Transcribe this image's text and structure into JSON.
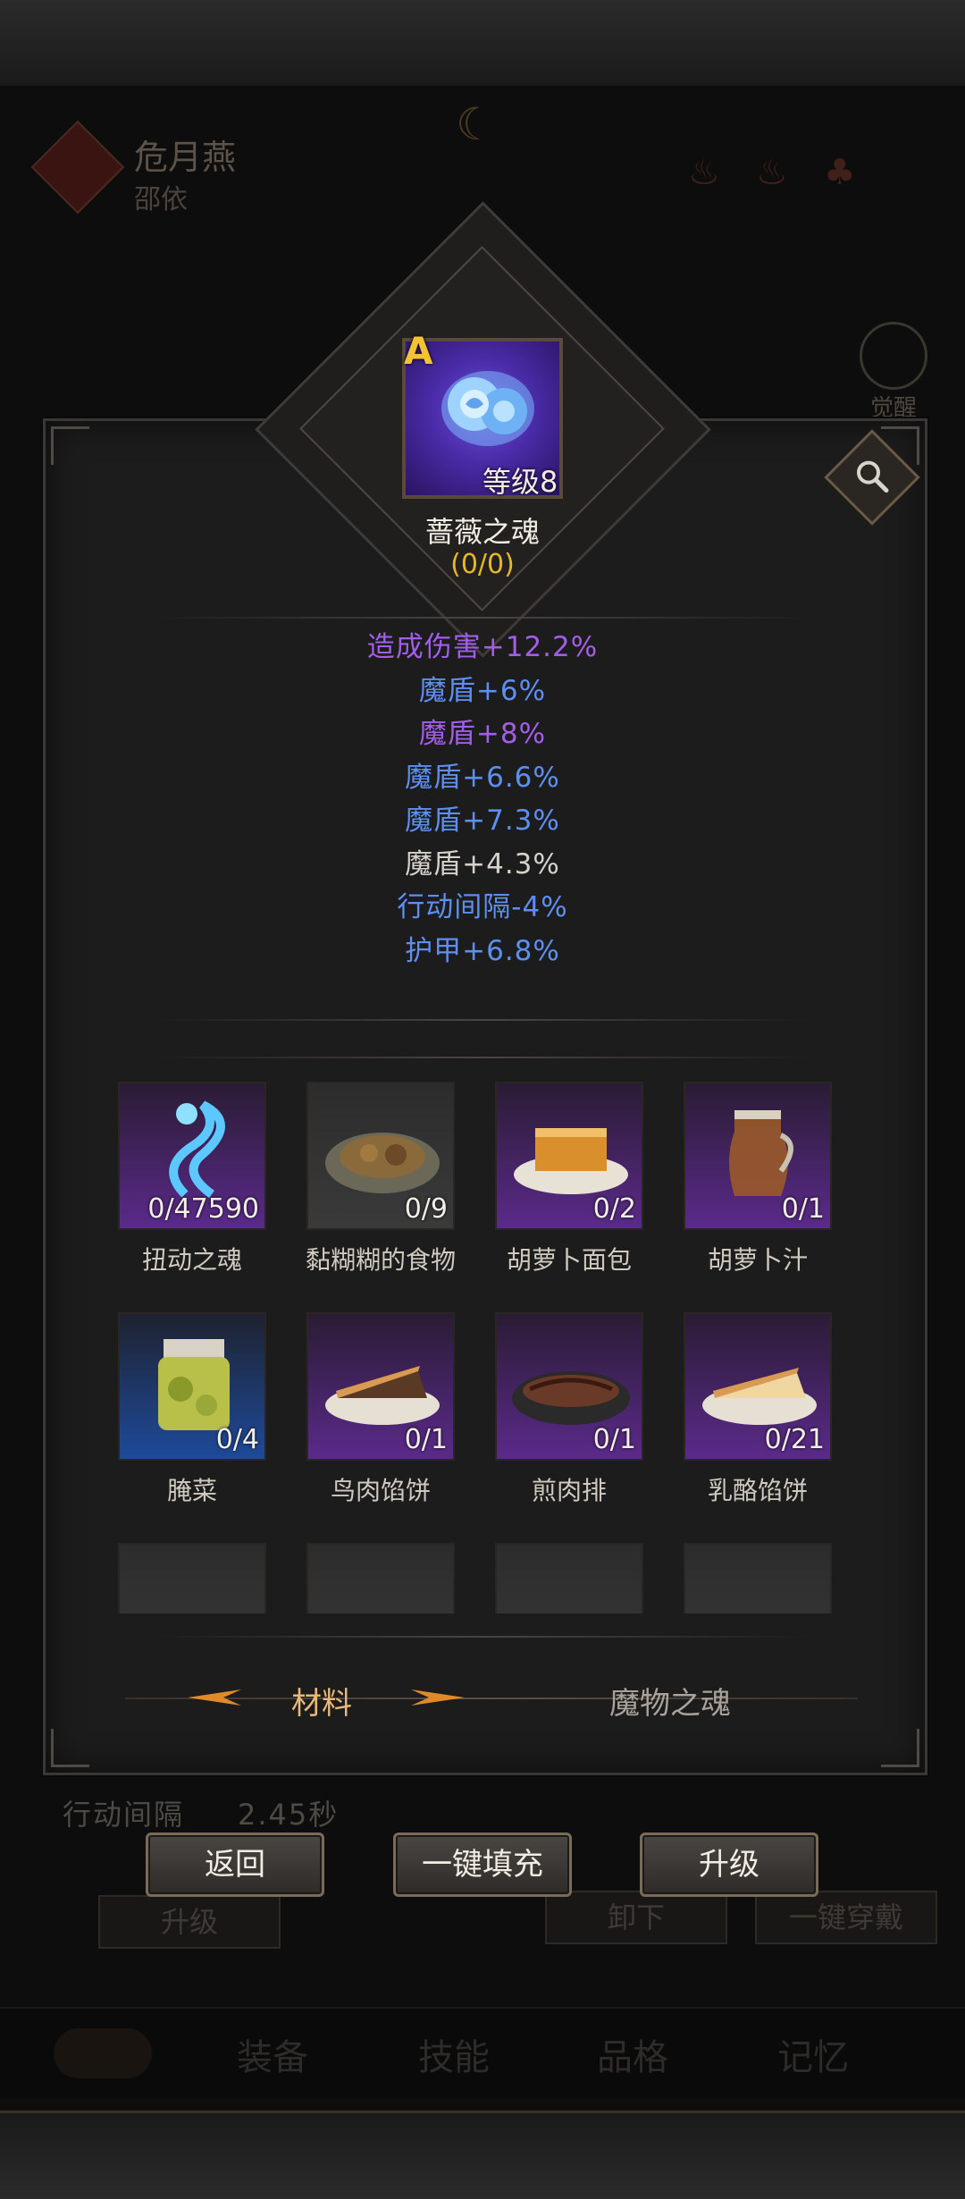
{
  "background": {
    "character_name": "危月燕",
    "character_sub": "邵依",
    "awaken_label": "觉醒",
    "interval_label": "行动间隔",
    "interval_value": "2.45秒",
    "buttons": [
      "升级",
      "卸下",
      "一键穿戴"
    ],
    "tabs": [
      "装备",
      "技能",
      "品格",
      "记忆"
    ]
  },
  "item": {
    "grade": "A",
    "level": "等级8",
    "name": "蔷薇之魂",
    "count": "(0/0)",
    "colors": {
      "grade": "#f3c331",
      "count": "#e7b72a"
    }
  },
  "stats": [
    {
      "text": "造成伤害+12.2%",
      "color": "#a25ee8"
    },
    {
      "text": "魔盾+6%",
      "color": "#5d8ef0"
    },
    {
      "text": "魔盾+8%",
      "color": "#a25ee8"
    },
    {
      "text": "魔盾+6.6%",
      "color": "#5d8ef0"
    },
    {
      "text": "魔盾+7.3%",
      "color": "#5d8ef0"
    },
    {
      "text": "魔盾+4.3%",
      "color": "#d6d2cb"
    },
    {
      "text": "行动间隔-4%",
      "color": "#5d8ef0"
    },
    {
      "text": "护甲+6.8%",
      "color": "#5d8ef0"
    }
  ],
  "materials": [
    {
      "name": "扭动之魂",
      "count": "0/47590",
      "rarity": "purple",
      "icon": "wisp-icon"
    },
    {
      "name": "黏糊糊的食物",
      "count": "0/9",
      "rarity": "gray",
      "icon": "mush-plate-icon"
    },
    {
      "name": "胡萝卜面包",
      "count": "0/2",
      "rarity": "purple",
      "icon": "bread-icon"
    },
    {
      "name": "胡萝卜汁",
      "count": "0/1",
      "rarity": "purple",
      "icon": "juice-jug-icon"
    },
    {
      "name": "腌菜",
      "count": "0/4",
      "rarity": "blue",
      "icon": "pickle-jar-icon"
    },
    {
      "name": "鸟肉馅饼",
      "count": "0/1",
      "rarity": "purple",
      "icon": "meat-pie-icon"
    },
    {
      "name": "煎肉排",
      "count": "0/1",
      "rarity": "purple",
      "icon": "steak-icon"
    },
    {
      "name": "乳酪馅饼",
      "count": "0/21",
      "rarity": "purple",
      "icon": "cheese-pie-icon"
    },
    {
      "name": "",
      "count": "",
      "rarity": "gray",
      "icon": "pie-icon"
    },
    {
      "name": "",
      "count": "",
      "rarity": "gray",
      "icon": "stew-icon"
    },
    {
      "name": "",
      "count": "",
      "rarity": "gray",
      "icon": "dish-icon"
    },
    {
      "name": "",
      "count": "",
      "rarity": "gray",
      "icon": "meat-icon"
    }
  ],
  "tabs": {
    "active": "材料",
    "inactive": "魔物之魂"
  },
  "actions": {
    "back": "返回",
    "auto_fill": "一键填充",
    "upgrade": "升级"
  }
}
